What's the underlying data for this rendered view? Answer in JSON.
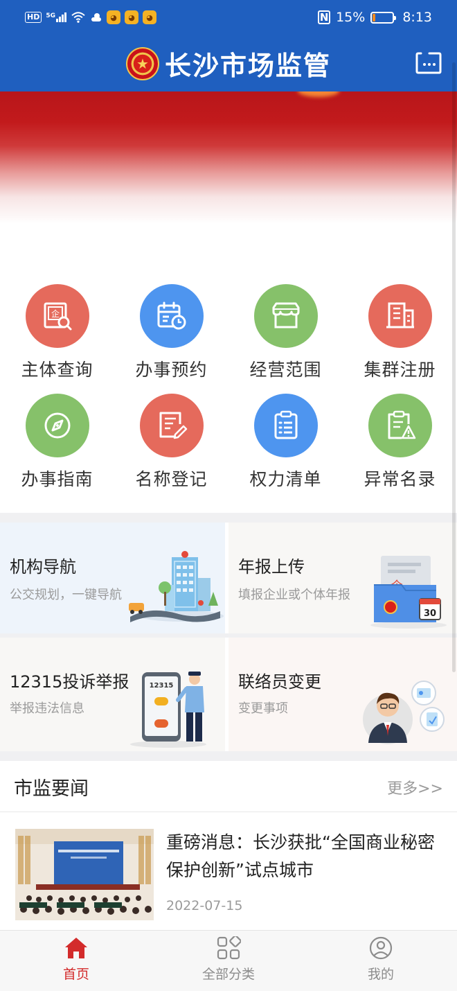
{
  "status_bar": {
    "hd": "HD",
    "network": "5G",
    "battery_text": "15%",
    "battery_level": 0.15,
    "time": "8:13"
  },
  "header": {
    "title": "长沙市场监管",
    "emblem_icon": "national-emblem",
    "scan_icon": "scan-icon"
  },
  "services": [
    {
      "label": "主体查询",
      "icon": "enterprise-search-icon",
      "color": "#e56a5c"
    },
    {
      "label": "办事预约",
      "icon": "calendar-clock-icon",
      "color": "#4e95ef"
    },
    {
      "label": "经营范围",
      "icon": "storefront-icon",
      "color": "#86c16a"
    },
    {
      "label": "集群注册",
      "icon": "building-icon",
      "color": "#e56a5c"
    },
    {
      "label": "办事指南",
      "icon": "compass-icon",
      "color": "#86c16a"
    },
    {
      "label": "名称登记",
      "icon": "document-edit-icon",
      "color": "#e56a5c"
    },
    {
      "label": "权力清单",
      "icon": "checklist-icon",
      "color": "#4e95ef"
    },
    {
      "label": "异常名录",
      "icon": "clipboard-warning-icon",
      "color": "#86c16a"
    }
  ],
  "cards": {
    "org_nav": {
      "title": "机构导航",
      "subtitle": "公交规划，一键导航"
    },
    "annual_report": {
      "title": "年报上传",
      "subtitle": "填报企业或个体年报",
      "calendar_day": "30",
      "doc_char": "企"
    },
    "complaint": {
      "title": "12315投诉举报",
      "subtitle": "举报违法信息",
      "phone_number": "12315"
    },
    "liaison": {
      "title": "联络员变更",
      "subtitle": "变更事项"
    }
  },
  "news": {
    "section_title": "市监要闻",
    "more": "更多>>",
    "items": [
      {
        "headline": "重磅消息：长沙获批“全国商业秘密保护创新”试点城市",
        "date": "2022-07-15"
      }
    ]
  },
  "tabbar": {
    "items": [
      {
        "label": "首页",
        "icon": "home-icon",
        "active": true
      },
      {
        "label": "全部分类",
        "icon": "categories-icon",
        "active": false
      },
      {
        "label": "我的",
        "icon": "profile-icon",
        "active": false
      }
    ]
  }
}
